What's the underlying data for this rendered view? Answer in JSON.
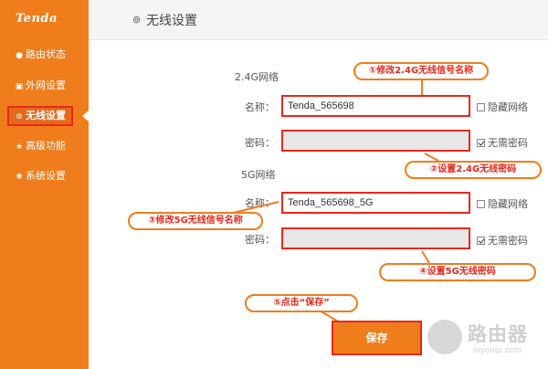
{
  "sidebar": {
    "logo": "Tenda",
    "items": [
      {
        "label": "路由状态",
        "icon": "dashboard-icon"
      },
      {
        "label": "外网设置",
        "icon": "internet-icon"
      },
      {
        "label": "无线设置",
        "icon": "wifi-icon",
        "active": true
      },
      {
        "label": "高级功能",
        "icon": "star-icon"
      },
      {
        "label": "系统设置",
        "icon": "gear-icon"
      }
    ]
  },
  "header": {
    "title": "无线设置",
    "icon": "wifi-icon"
  },
  "band_24": {
    "section": "2.4G网络",
    "name_label": "名称：",
    "name_value": "Tenda_565698",
    "hide_label": "隐藏网络",
    "hide_checked": false,
    "pwd_label": "密码：",
    "pwd_value": "",
    "no_pwd_label": "无需密码",
    "no_pwd_checked": true
  },
  "band_5": {
    "section": "5G网络",
    "name_label": "名称：",
    "name_value": "Tenda_565698_5G",
    "hide_label": "隐藏网络",
    "hide_checked": false,
    "pwd_label": "密码：",
    "pwd_value": "",
    "no_pwd_label": "无需密码",
    "no_pwd_checked": true
  },
  "annotations": {
    "step1": "①修改2.4G无线信号名称",
    "step2": "②设置2.4G无线密码",
    "step3": "③修改5G无线信号名称",
    "step4": "④设置5G无线密码",
    "step5": "⑤点击“保存”"
  },
  "save_label": "保存",
  "watermark": {
    "line1": "路由器",
    "line2": "luyouqi.com"
  },
  "colors": {
    "sidebar": "#f07d1c",
    "highlight": "#e8281c",
    "header_bg": "#f5f5f5"
  }
}
